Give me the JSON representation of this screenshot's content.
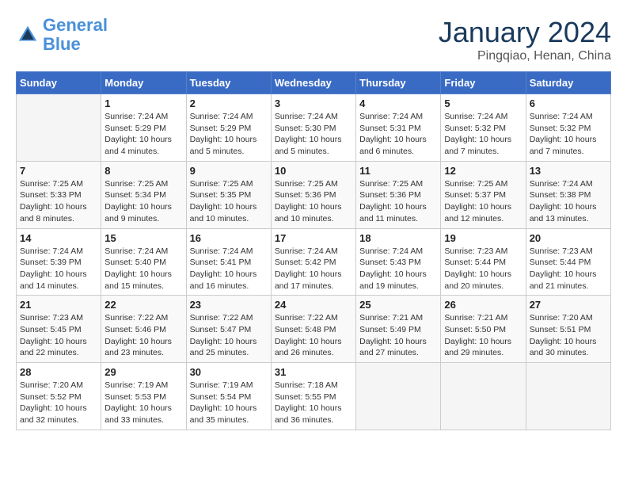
{
  "header": {
    "logo_line1": "General",
    "logo_line2": "Blue",
    "month": "January 2024",
    "location": "Pingqiao, Henan, China"
  },
  "weekdays": [
    "Sunday",
    "Monday",
    "Tuesday",
    "Wednesday",
    "Thursday",
    "Friday",
    "Saturday"
  ],
  "weeks": [
    [
      {
        "day": "",
        "info": ""
      },
      {
        "day": "1",
        "info": "Sunrise: 7:24 AM\nSunset: 5:29 PM\nDaylight: 10 hours\nand 4 minutes."
      },
      {
        "day": "2",
        "info": "Sunrise: 7:24 AM\nSunset: 5:29 PM\nDaylight: 10 hours\nand 5 minutes."
      },
      {
        "day": "3",
        "info": "Sunrise: 7:24 AM\nSunset: 5:30 PM\nDaylight: 10 hours\nand 5 minutes."
      },
      {
        "day": "4",
        "info": "Sunrise: 7:24 AM\nSunset: 5:31 PM\nDaylight: 10 hours\nand 6 minutes."
      },
      {
        "day": "5",
        "info": "Sunrise: 7:24 AM\nSunset: 5:32 PM\nDaylight: 10 hours\nand 7 minutes."
      },
      {
        "day": "6",
        "info": "Sunrise: 7:24 AM\nSunset: 5:32 PM\nDaylight: 10 hours\nand 7 minutes."
      }
    ],
    [
      {
        "day": "7",
        "info": "Sunrise: 7:25 AM\nSunset: 5:33 PM\nDaylight: 10 hours\nand 8 minutes."
      },
      {
        "day": "8",
        "info": "Sunrise: 7:25 AM\nSunset: 5:34 PM\nDaylight: 10 hours\nand 9 minutes."
      },
      {
        "day": "9",
        "info": "Sunrise: 7:25 AM\nSunset: 5:35 PM\nDaylight: 10 hours\nand 10 minutes."
      },
      {
        "day": "10",
        "info": "Sunrise: 7:25 AM\nSunset: 5:36 PM\nDaylight: 10 hours\nand 10 minutes."
      },
      {
        "day": "11",
        "info": "Sunrise: 7:25 AM\nSunset: 5:36 PM\nDaylight: 10 hours\nand 11 minutes."
      },
      {
        "day": "12",
        "info": "Sunrise: 7:25 AM\nSunset: 5:37 PM\nDaylight: 10 hours\nand 12 minutes."
      },
      {
        "day": "13",
        "info": "Sunrise: 7:24 AM\nSunset: 5:38 PM\nDaylight: 10 hours\nand 13 minutes."
      }
    ],
    [
      {
        "day": "14",
        "info": "Sunrise: 7:24 AM\nSunset: 5:39 PM\nDaylight: 10 hours\nand 14 minutes."
      },
      {
        "day": "15",
        "info": "Sunrise: 7:24 AM\nSunset: 5:40 PM\nDaylight: 10 hours\nand 15 minutes."
      },
      {
        "day": "16",
        "info": "Sunrise: 7:24 AM\nSunset: 5:41 PM\nDaylight: 10 hours\nand 16 minutes."
      },
      {
        "day": "17",
        "info": "Sunrise: 7:24 AM\nSunset: 5:42 PM\nDaylight: 10 hours\nand 17 minutes."
      },
      {
        "day": "18",
        "info": "Sunrise: 7:24 AM\nSunset: 5:43 PM\nDaylight: 10 hours\nand 19 minutes."
      },
      {
        "day": "19",
        "info": "Sunrise: 7:23 AM\nSunset: 5:44 PM\nDaylight: 10 hours\nand 20 minutes."
      },
      {
        "day": "20",
        "info": "Sunrise: 7:23 AM\nSunset: 5:44 PM\nDaylight: 10 hours\nand 21 minutes."
      }
    ],
    [
      {
        "day": "21",
        "info": "Sunrise: 7:23 AM\nSunset: 5:45 PM\nDaylight: 10 hours\nand 22 minutes."
      },
      {
        "day": "22",
        "info": "Sunrise: 7:22 AM\nSunset: 5:46 PM\nDaylight: 10 hours\nand 23 minutes."
      },
      {
        "day": "23",
        "info": "Sunrise: 7:22 AM\nSunset: 5:47 PM\nDaylight: 10 hours\nand 25 minutes."
      },
      {
        "day": "24",
        "info": "Sunrise: 7:22 AM\nSunset: 5:48 PM\nDaylight: 10 hours\nand 26 minutes."
      },
      {
        "day": "25",
        "info": "Sunrise: 7:21 AM\nSunset: 5:49 PM\nDaylight: 10 hours\nand 27 minutes."
      },
      {
        "day": "26",
        "info": "Sunrise: 7:21 AM\nSunset: 5:50 PM\nDaylight: 10 hours\nand 29 minutes."
      },
      {
        "day": "27",
        "info": "Sunrise: 7:20 AM\nSunset: 5:51 PM\nDaylight: 10 hours\nand 30 minutes."
      }
    ],
    [
      {
        "day": "28",
        "info": "Sunrise: 7:20 AM\nSunset: 5:52 PM\nDaylight: 10 hours\nand 32 minutes."
      },
      {
        "day": "29",
        "info": "Sunrise: 7:19 AM\nSunset: 5:53 PM\nDaylight: 10 hours\nand 33 minutes."
      },
      {
        "day": "30",
        "info": "Sunrise: 7:19 AM\nSunset: 5:54 PM\nDaylight: 10 hours\nand 35 minutes."
      },
      {
        "day": "31",
        "info": "Sunrise: 7:18 AM\nSunset: 5:55 PM\nDaylight: 10 hours\nand 36 minutes."
      },
      {
        "day": "",
        "info": ""
      },
      {
        "day": "",
        "info": ""
      },
      {
        "day": "",
        "info": ""
      }
    ]
  ]
}
